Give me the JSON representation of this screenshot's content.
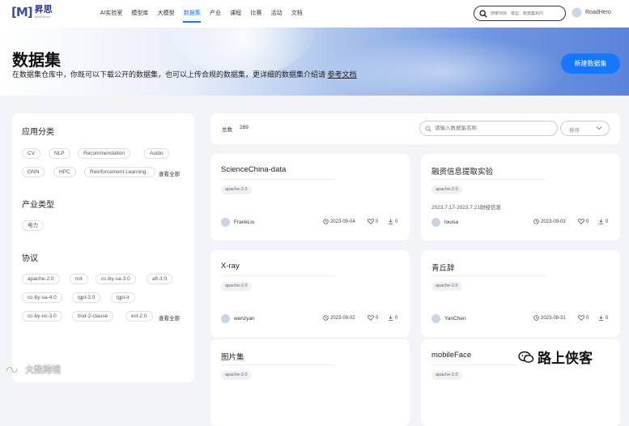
{
  "nav": {
    "logo_mark": "[M]",
    "logo_cn": "昇思",
    "logo_en": "MindSpore",
    "menu": [
      "AI实验室",
      "模型库",
      "大模型",
      "数据集",
      "产业",
      "课程",
      "比赛",
      "活动",
      "文档"
    ],
    "active_index": 3,
    "search_placeholder": "搜索项目、模型、数据集和内",
    "username": "RoadHero"
  },
  "banner": {
    "title": "数据集",
    "desc": "在数据集仓库中，你既可以下载公开的数据集，也可以上传合规的数据集，更详细的数据集介绍请",
    "link": "参考文档",
    "new_button": "新建数据集"
  },
  "sidebar": {
    "app_title": "应用分类",
    "app_tags": [
      "CV",
      "NLP",
      "Recommendation",
      "Audio",
      "GNN",
      "HPC",
      "Reinforcement Learning"
    ],
    "app_see_all": "查看全部",
    "industry_title": "产业类型",
    "industry_tags": [
      "电力"
    ],
    "license_title": "协议",
    "license_tags": [
      "apache-2.0",
      "mit",
      "cc-by-sa-3.0",
      "afl-3.0",
      "cc-by-sa-4.0",
      "lgpl-3.0",
      "lgpl-lr",
      "cc-by-nc-3.0",
      "bsd-2-clause",
      "ecl-2.0"
    ],
    "license_see_all": "查看全部"
  },
  "toolbar": {
    "total_label": "总数",
    "total_count": "289",
    "search_placeholder": "请输入数据集名称",
    "sort_label": "排序"
  },
  "cards": [
    {
      "title": "ScienceChina-data",
      "tag": "apache-2.0",
      "desc": "",
      "author": "FrankLiu",
      "date": "2023-09-04",
      "likes": "0",
      "downloads": "0"
    },
    {
      "title": "融资信息提取实验",
      "tag": "apache-2.0",
      "desc": "2023.7.17-2023.7.21财经信息",
      "author": "louisa",
      "date": "2023-09-03",
      "likes": "0",
      "downloads": "0"
    },
    {
      "title": "X-ray",
      "tag": "apache-2.0",
      "desc": "",
      "author": "wenzyan",
      "date": "2023-09-02",
      "likes": "0",
      "downloads": "0"
    },
    {
      "title": "青丘辞",
      "tag": "apache-2.0",
      "desc": "",
      "author": "YanChen",
      "date": "2023-08-31",
      "likes": "0",
      "downloads": "0"
    },
    {
      "title": "图片集",
      "tag": "apache-2.0",
      "desc": "",
      "author": "",
      "date": "",
      "likes": "",
      "downloads": ""
    },
    {
      "title": "mobileFace",
      "tag": "apache-2.0",
      "desc": "",
      "author": "",
      "date": "",
      "likes": "",
      "downloads": ""
    }
  ],
  "watermarks": {
    "left": "大数跨境",
    "right": "路上侠客"
  },
  "colors": {
    "accent": "#1677ff",
    "logo": "#3b4aa8"
  }
}
